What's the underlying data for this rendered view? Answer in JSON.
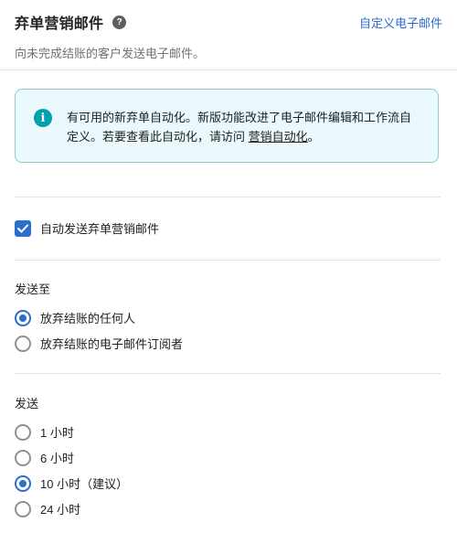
{
  "header": {
    "title": "弃单营销邮件",
    "subtitle": "向未完成结账的客户发送电子邮件。",
    "customize_link": "自定义电子邮件"
  },
  "banner": {
    "text": "有可用的新弃单自动化。新版功能改进了电子邮件编辑和工作流自定义。若要查看此自动化，请访问 ",
    "link": "营销自动化",
    "text_end": "。"
  },
  "auto_send": {
    "label": "自动发送弃单营销邮件",
    "checked": true
  },
  "send_to": {
    "label": "发送至",
    "options": [
      {
        "label": "放弃结账的任何人",
        "selected": true
      },
      {
        "label": "放弃结账的电子邮件订阅者",
        "selected": false
      }
    ]
  },
  "send_after": {
    "label": "发送",
    "options": [
      {
        "label": "1 小时",
        "selected": false
      },
      {
        "label": "6 小时",
        "selected": false
      },
      {
        "label": "10 小时（建议）",
        "selected": true
      },
      {
        "label": "24 小时",
        "selected": false
      }
    ]
  },
  "colors": {
    "accent": "#2c6ecb",
    "info_icon": "#00a0ac",
    "banner_bg": "#ebf9fc",
    "banner_border": "#98c6cd"
  }
}
